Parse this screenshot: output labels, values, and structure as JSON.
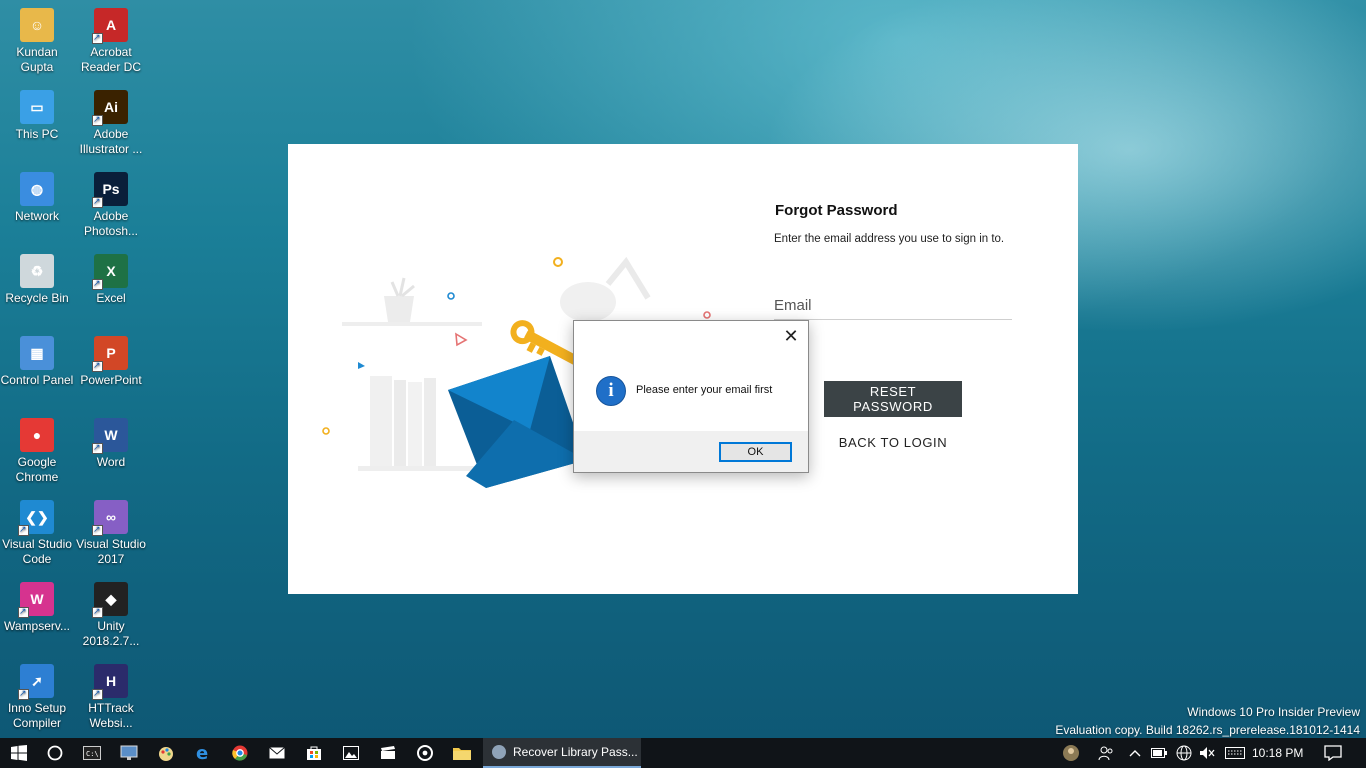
{
  "desktop": {
    "icons": [
      {
        "label": "Kundan Gupta",
        "icon": "user-folder-icon",
        "color": "#e8b84a"
      },
      {
        "label": "Acrobat Reader DC",
        "icon": "acrobat-icon",
        "color": "#c62828"
      },
      {
        "label": "This PC",
        "icon": "computer-icon",
        "color": "#3aa0e6"
      },
      {
        "label": "Adobe Illustrator ...",
        "icon": "illustrator-icon",
        "color": "#3a2200"
      },
      {
        "label": "Network",
        "icon": "network-icon",
        "color": "#3a8de0"
      },
      {
        "label": "Adobe Photosh...",
        "icon": "photoshop-icon",
        "color": "#0a1f3a"
      },
      {
        "label": "Recycle Bin",
        "icon": "recycle-bin-icon",
        "color": "#cfd8dc"
      },
      {
        "label": "Excel",
        "icon": "excel-icon",
        "color": "#1e7145"
      },
      {
        "label": "Control Panel",
        "icon": "control-panel-icon",
        "color": "#4a90d9"
      },
      {
        "label": "PowerPoint",
        "icon": "powerpoint-icon",
        "color": "#d24726"
      },
      {
        "label": "Google Chrome",
        "icon": "chrome-icon",
        "color": "#e53935"
      },
      {
        "label": "Word",
        "icon": "word-icon",
        "color": "#2b579a"
      },
      {
        "label": "Visual Studio Code",
        "icon": "vscode-icon",
        "color": "#1f8ad2"
      },
      {
        "label": "Visual Studio 2017",
        "icon": "visual-studio-icon",
        "color": "#865fc5"
      },
      {
        "label": "Wampserv...",
        "icon": "wampserver-icon",
        "color": "#d6338f"
      },
      {
        "label": "Unity 2018.2.7...",
        "icon": "unity-icon",
        "color": "#222222"
      },
      {
        "label": "Inno Setup Compiler",
        "icon": "inno-setup-icon",
        "color": "#2d7fd3"
      },
      {
        "label": "HTTrack Websi...",
        "icon": "httrack-icon",
        "color": "#2b2b6b"
      }
    ]
  },
  "app": {
    "title": "Forgot Password",
    "subtitle": "Enter the email address you use to sign in to.",
    "email_placeholder": "Email",
    "reset_button": "RESET PASSWORD",
    "back_link": "BACK TO LOGIN"
  },
  "dialog": {
    "message": "Please enter your email first",
    "ok_label": "OK",
    "icon": "info-icon"
  },
  "watermark": {
    "line1": "Windows 10 Pro Insider Preview",
    "line2": "Evaluation copy. Build 18262.rs_prerelease.181012-1414"
  },
  "taskbar": {
    "active_app_label": "Recover Library Pass...",
    "time": "10:18 PM",
    "accent": "#7aa8d8"
  },
  "colors": {
    "reset_button_bg": "#3b4346",
    "info_icon": "#1f6fc8",
    "envelope": "#0f75b8",
    "key": "#f2b01e"
  }
}
